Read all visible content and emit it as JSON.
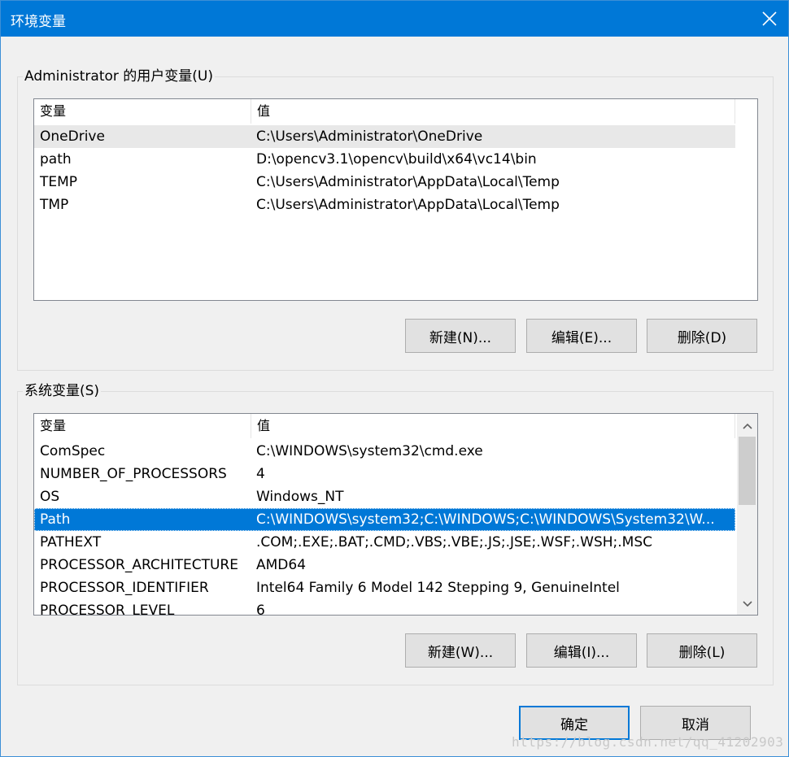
{
  "window": {
    "title": "环境变量",
    "close_icon": "close-icon"
  },
  "user_vars": {
    "group_label": "Administrator 的用户变量(U)",
    "columns": [
      "变量",
      "值"
    ],
    "rows": [
      {
        "name": "OneDrive",
        "value": "C:\\Users\\Administrator\\OneDrive"
      },
      {
        "name": "path",
        "value": "D:\\opencv3.1\\opencv\\build\\x64\\vc14\\bin"
      },
      {
        "name": "TEMP",
        "value": "C:\\Users\\Administrator\\AppData\\Local\\Temp"
      },
      {
        "name": "TMP",
        "value": "C:\\Users\\Administrator\\AppData\\Local\\Temp"
      }
    ],
    "buttons": {
      "new": "新建(N)...",
      "edit": "编辑(E)...",
      "delete": "删除(D)"
    }
  },
  "system_vars": {
    "group_label": "系统变量(S)",
    "columns": [
      "变量",
      "值"
    ],
    "rows": [
      {
        "name": "ComSpec",
        "value": "C:\\WINDOWS\\system32\\cmd.exe"
      },
      {
        "name": "NUMBER_OF_PROCESSORS",
        "value": "4"
      },
      {
        "name": "OS",
        "value": "Windows_NT"
      },
      {
        "name": "Path",
        "value": "C:\\WINDOWS\\system32;C:\\WINDOWS;C:\\WINDOWS\\System32\\W..."
      },
      {
        "name": "PATHEXT",
        "value": ".COM;.EXE;.BAT;.CMD;.VBS;.VBE;.JS;.JSE;.WSF;.WSH;.MSC"
      },
      {
        "name": "PROCESSOR_ARCHITECTURE",
        "value": "AMD64"
      },
      {
        "name": "PROCESSOR_IDENTIFIER",
        "value": "Intel64 Family 6 Model 142 Stepping 9, GenuineIntel"
      },
      {
        "name": "PROCESSOR_LEVEL",
        "value": "6"
      }
    ],
    "selected_row": "Path",
    "buttons": {
      "new": "新建(W)...",
      "edit": "编辑(I)...",
      "delete": "删除(L)"
    }
  },
  "dialog_buttons": {
    "ok": "确定",
    "cancel": "取消"
  },
  "watermark": "https://blog.csdn.net/qq_41202903",
  "colors": {
    "titlebar": "#0078d7",
    "selection": "#0078d7"
  }
}
